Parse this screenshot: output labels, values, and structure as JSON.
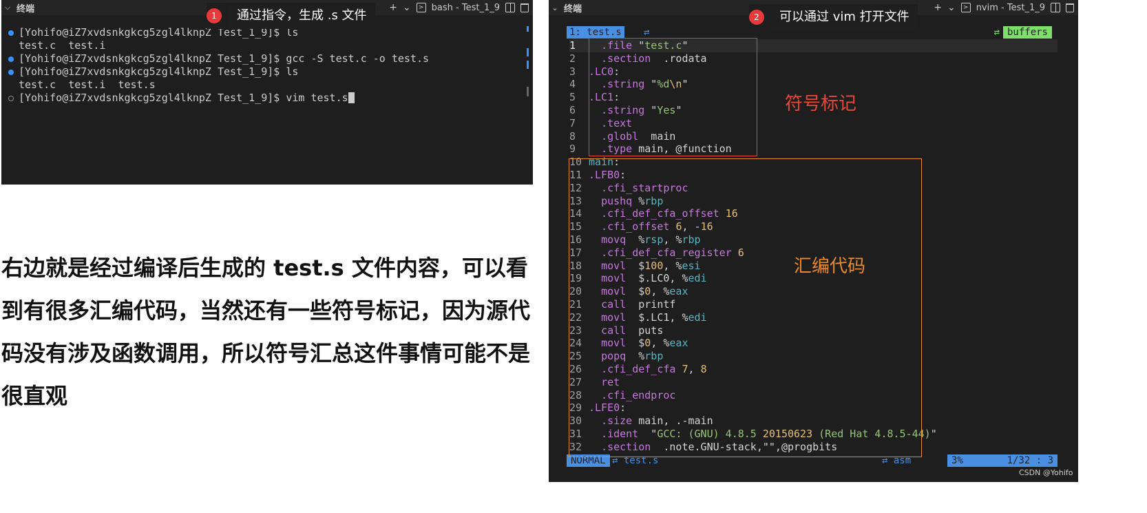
{
  "left_panel": {
    "title": "终端",
    "shell_tab": "bash - Test_1_9",
    "lines": [
      {
        "dot": "blue",
        "text": "[Yohifo@iZ7xvdsnkgkcg5zgl4lknpZ Test_1_9]$ ls"
      },
      {
        "dot": "none",
        "text": "test.c  test.i"
      },
      {
        "dot": "blue",
        "text": "[Yohifo@iZ7xvdsnkgkcg5zgl4lknpZ Test_1_9]$ gcc -S test.c -o test.s"
      },
      {
        "dot": "blue",
        "text": "[Yohifo@iZ7xvdsnkgkcg5zgl4lknpZ Test_1_9]$ ls"
      },
      {
        "dot": "none",
        "text": "test.c  test.i  test.s"
      },
      {
        "dot": "hollow",
        "text": "[Yohifo@iZ7xvdsnkgkcg5zgl4lknpZ Test_1_9]$ vim test.s"
      }
    ]
  },
  "callouts": [
    {
      "number": "1",
      "text": "通过指令，生成 .s 文件"
    },
    {
      "number": "2",
      "text": "可以通过 vim 打开文件"
    }
  ],
  "description": "右边就是经过编译后生成的 test.s 文件内容，可以看到有很多汇编代码，当然还有一些符号标记，因为源代码没有涉及函数调用，所以符号汇总这件事情可能不是很直观",
  "right_panel": {
    "title": "终端",
    "shell_tab": "nvim - Test_1_9",
    "vim_tab": "1: test.s",
    "buffers_label": "buffers",
    "code_lines": [
      ".file \"test.c\"",
      ".section  .rodata",
      ".LC0:",
      ".string \"%d\\n\"",
      ".LC1:",
      ".string \"Yes\"",
      ".text",
      ".globl  main",
      ".type main, @function",
      "main:",
      ".LFB0:",
      ".cfi_startproc",
      "pushq %rbp",
      ".cfi_def_cfa_offset 16",
      ".cfi_offset 6, -16",
      "movq  %rsp, %rbp",
      ".cfi_def_cfa_register 6",
      "movl  $100, %esi",
      "movl  $.LC0, %edi",
      "movl  $0, %eax",
      "call  printf",
      "movl  $.LC1, %edi",
      "call  puts",
      "movl  $0, %eax",
      "popq  %rbp",
      ".cfi_def_cfa 7, 8",
      "ret",
      ".cfi_endproc",
      ".LFE0:",
      ".size main, .-main",
      ".ident  \"GCC: (GNU) 4.8.5 20150623 (Red Hat 4.8.5-44)\"",
      ".section  .note.GNU-stack,\"\",@progbits"
    ],
    "annotation_symbols": "符号标记",
    "annotation_asm": "汇编代码",
    "status": {
      "mode": "NORMAL",
      "file": "test.s",
      "filetype": "asm",
      "percent": "3%",
      "position": "1/32 :  3"
    }
  },
  "watermark": "CSDN @Yohifo",
  "colors": {
    "accent_blue": "#4a90e2",
    "buffers_green": "#7ee06a",
    "box_red": "#e8483a",
    "box_orange": "#e88a2a",
    "badge_red": "#e83a3a"
  }
}
